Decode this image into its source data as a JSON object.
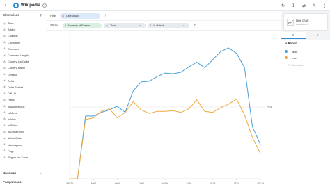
{
  "header": {
    "back_icon": "chevron-left-icon",
    "datasource_title": "Wikipedia",
    "actions": [
      "refresh-icon",
      "download-icon",
      "share-icon",
      "edit-icon",
      "more-icon"
    ]
  },
  "left_panel": {
    "dimensions_title": "Dimensions",
    "dimensions": [
      {
        "label": "Time",
        "icon": "clock-icon"
      },
      {
        "label": "Added",
        "icon": "hash-icon"
      },
      {
        "label": "Channel",
        "icon": "string-icon"
      },
      {
        "label": "City Name",
        "icon": "string-icon"
      },
      {
        "label": "Comment",
        "icon": "string-icon"
      },
      {
        "label": "Comment Length",
        "icon": "hash-icon"
      },
      {
        "label": "Country Iso Code",
        "icon": "string-icon"
      },
      {
        "label": "Country Name",
        "icon": "string-icon"
      },
      {
        "label": "Deleted",
        "icon": "hash-icon"
      },
      {
        "label": "Delta",
        "icon": "hash-icon"
      },
      {
        "label": "Delta Bucket",
        "icon": "hash-icon"
      },
      {
        "label": "Diff Url",
        "icon": "string-icon"
      },
      {
        "label": "Flags",
        "icon": "string-icon"
      },
      {
        "label": "Is Anonymous",
        "icon": "string-icon"
      },
      {
        "label": "Is Minor",
        "icon": "string-icon"
      },
      {
        "label": "Is New",
        "icon": "string-icon"
      },
      {
        "label": "Is Robot",
        "icon": "string-icon"
      },
      {
        "label": "Is Unpatrolled",
        "icon": "string-icon"
      },
      {
        "label": "Metro Code",
        "icon": "hash-icon"
      },
      {
        "label": "Namespace",
        "icon": "string-icon"
      },
      {
        "label": "Page",
        "icon": "string-icon"
      },
      {
        "label": "Region Iso Code",
        "icon": "string-icon"
      }
    ],
    "measures_title": "Measures",
    "comparisons_title": "Comparisons"
  },
  "filter_bar": {
    "label": "Filter",
    "pill": "Latest day"
  },
  "show_bar": {
    "label": "Show",
    "measure_pill": "Number of Events",
    "split_pills": [
      "Time",
      "Is Robot"
    ]
  },
  "chart_data": {
    "type": "line",
    "x": [
      "10PM",
      "11PM",
      "12AM",
      "1AM",
      "2AM",
      "3AM",
      "4AM",
      "5AM",
      "6AM",
      "7AM",
      "8AM",
      "9AM",
      "10AM",
      "11AM",
      "12PM",
      "1PM",
      "2PM",
      "3PM",
      "4PM",
      "5PM",
      "6PM",
      "7PM",
      "8PM",
      "9PM",
      "10PM"
    ],
    "xticks": [
      "10PM",
      "1AM",
      "4AM",
      "7AM",
      "10AM",
      "1PM",
      "4PM",
      "7PM",
      "10PM"
    ],
    "yticks": [
      "20K"
    ],
    "ylim": [
      0,
      40000
    ],
    "grid": "horizontal line at 20K",
    "series": [
      {
        "name": "false",
        "color": "#4b9fd9",
        "values": [
          0,
          0,
          17500,
          17500,
          18500,
          19200,
          20200,
          18500,
          24500,
          27000,
          27200,
          28500,
          29500,
          29300,
          29700,
          31200,
          32500,
          31000,
          33200,
          35500,
          36500,
          35000,
          31000,
          14500,
          9500
        ]
      },
      {
        "name": "true",
        "color": "#f0a83e",
        "values": [
          0,
          0,
          16500,
          17000,
          18800,
          19500,
          17000,
          18500,
          21500,
          19200,
          18200,
          18800,
          18800,
          19000,
          18500,
          19500,
          22000,
          18800,
          18500,
          19800,
          20800,
          22200,
          17800,
          11500,
          7000
        ]
      }
    ]
  },
  "right_panel": {
    "visualization_title": "Line chart",
    "visualization_subtitle": "Auto select",
    "tabs": [
      "settings-icon",
      "filter-icon"
    ],
    "legend_title": "Is Robot",
    "legend": [
      {
        "label": "false",
        "color": "#4b9fd9"
      },
      {
        "label": "true",
        "color": "#f0a83e"
      }
    ],
    "add_label": "Pin dimension"
  },
  "colors": {
    "accent": "#2b8ed3",
    "series_false": "#4b9fd9",
    "series_true": "#f0a83e"
  }
}
